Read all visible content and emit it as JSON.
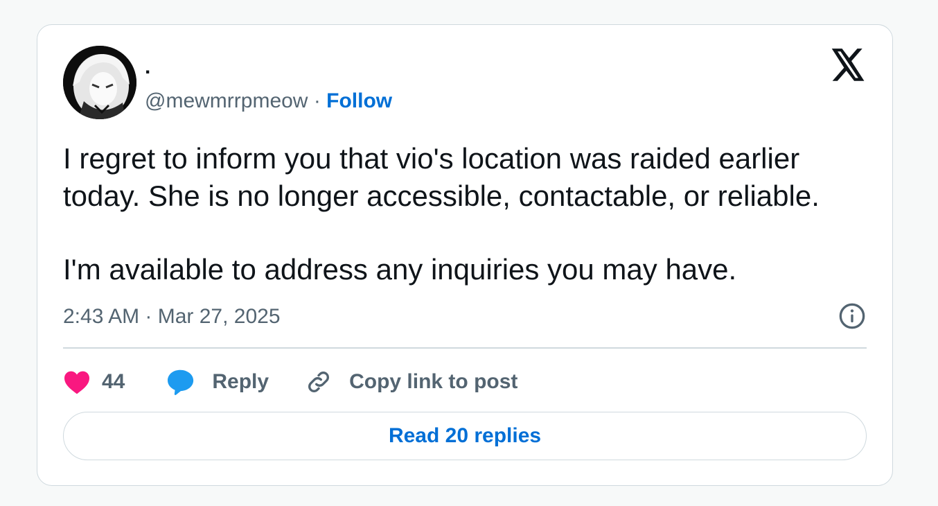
{
  "author": {
    "display_name": ".",
    "handle": "@mewmrrpmeow",
    "separator": " · ",
    "follow_label": "Follow"
  },
  "tweet": {
    "lines_paragraph_1": [
      "I regret to inform you that vio's location was raided earlier",
      "today. She is no longer accessible, contactable, or reliable."
    ],
    "paragraph_2": "I'm available to address any inquiries you may have.",
    "timestamp": "2:43 AM · Mar 27, 2025"
  },
  "actions": {
    "like_count": "44",
    "reply_label": "Reply",
    "copy_label": "Copy link to post"
  },
  "read_replies_label": "Read 20 replies",
  "icons": {
    "brand": "x-logo-icon",
    "info": "info-icon",
    "like": "heart-icon",
    "reply": "speech-bubble-icon",
    "copy": "link-icon"
  },
  "colors": {
    "like": "#f91880",
    "reply": "#1d9bf0",
    "link": "#006fd6",
    "muted": "#536471",
    "text": "#0f1419",
    "border": "#cfd9de"
  }
}
